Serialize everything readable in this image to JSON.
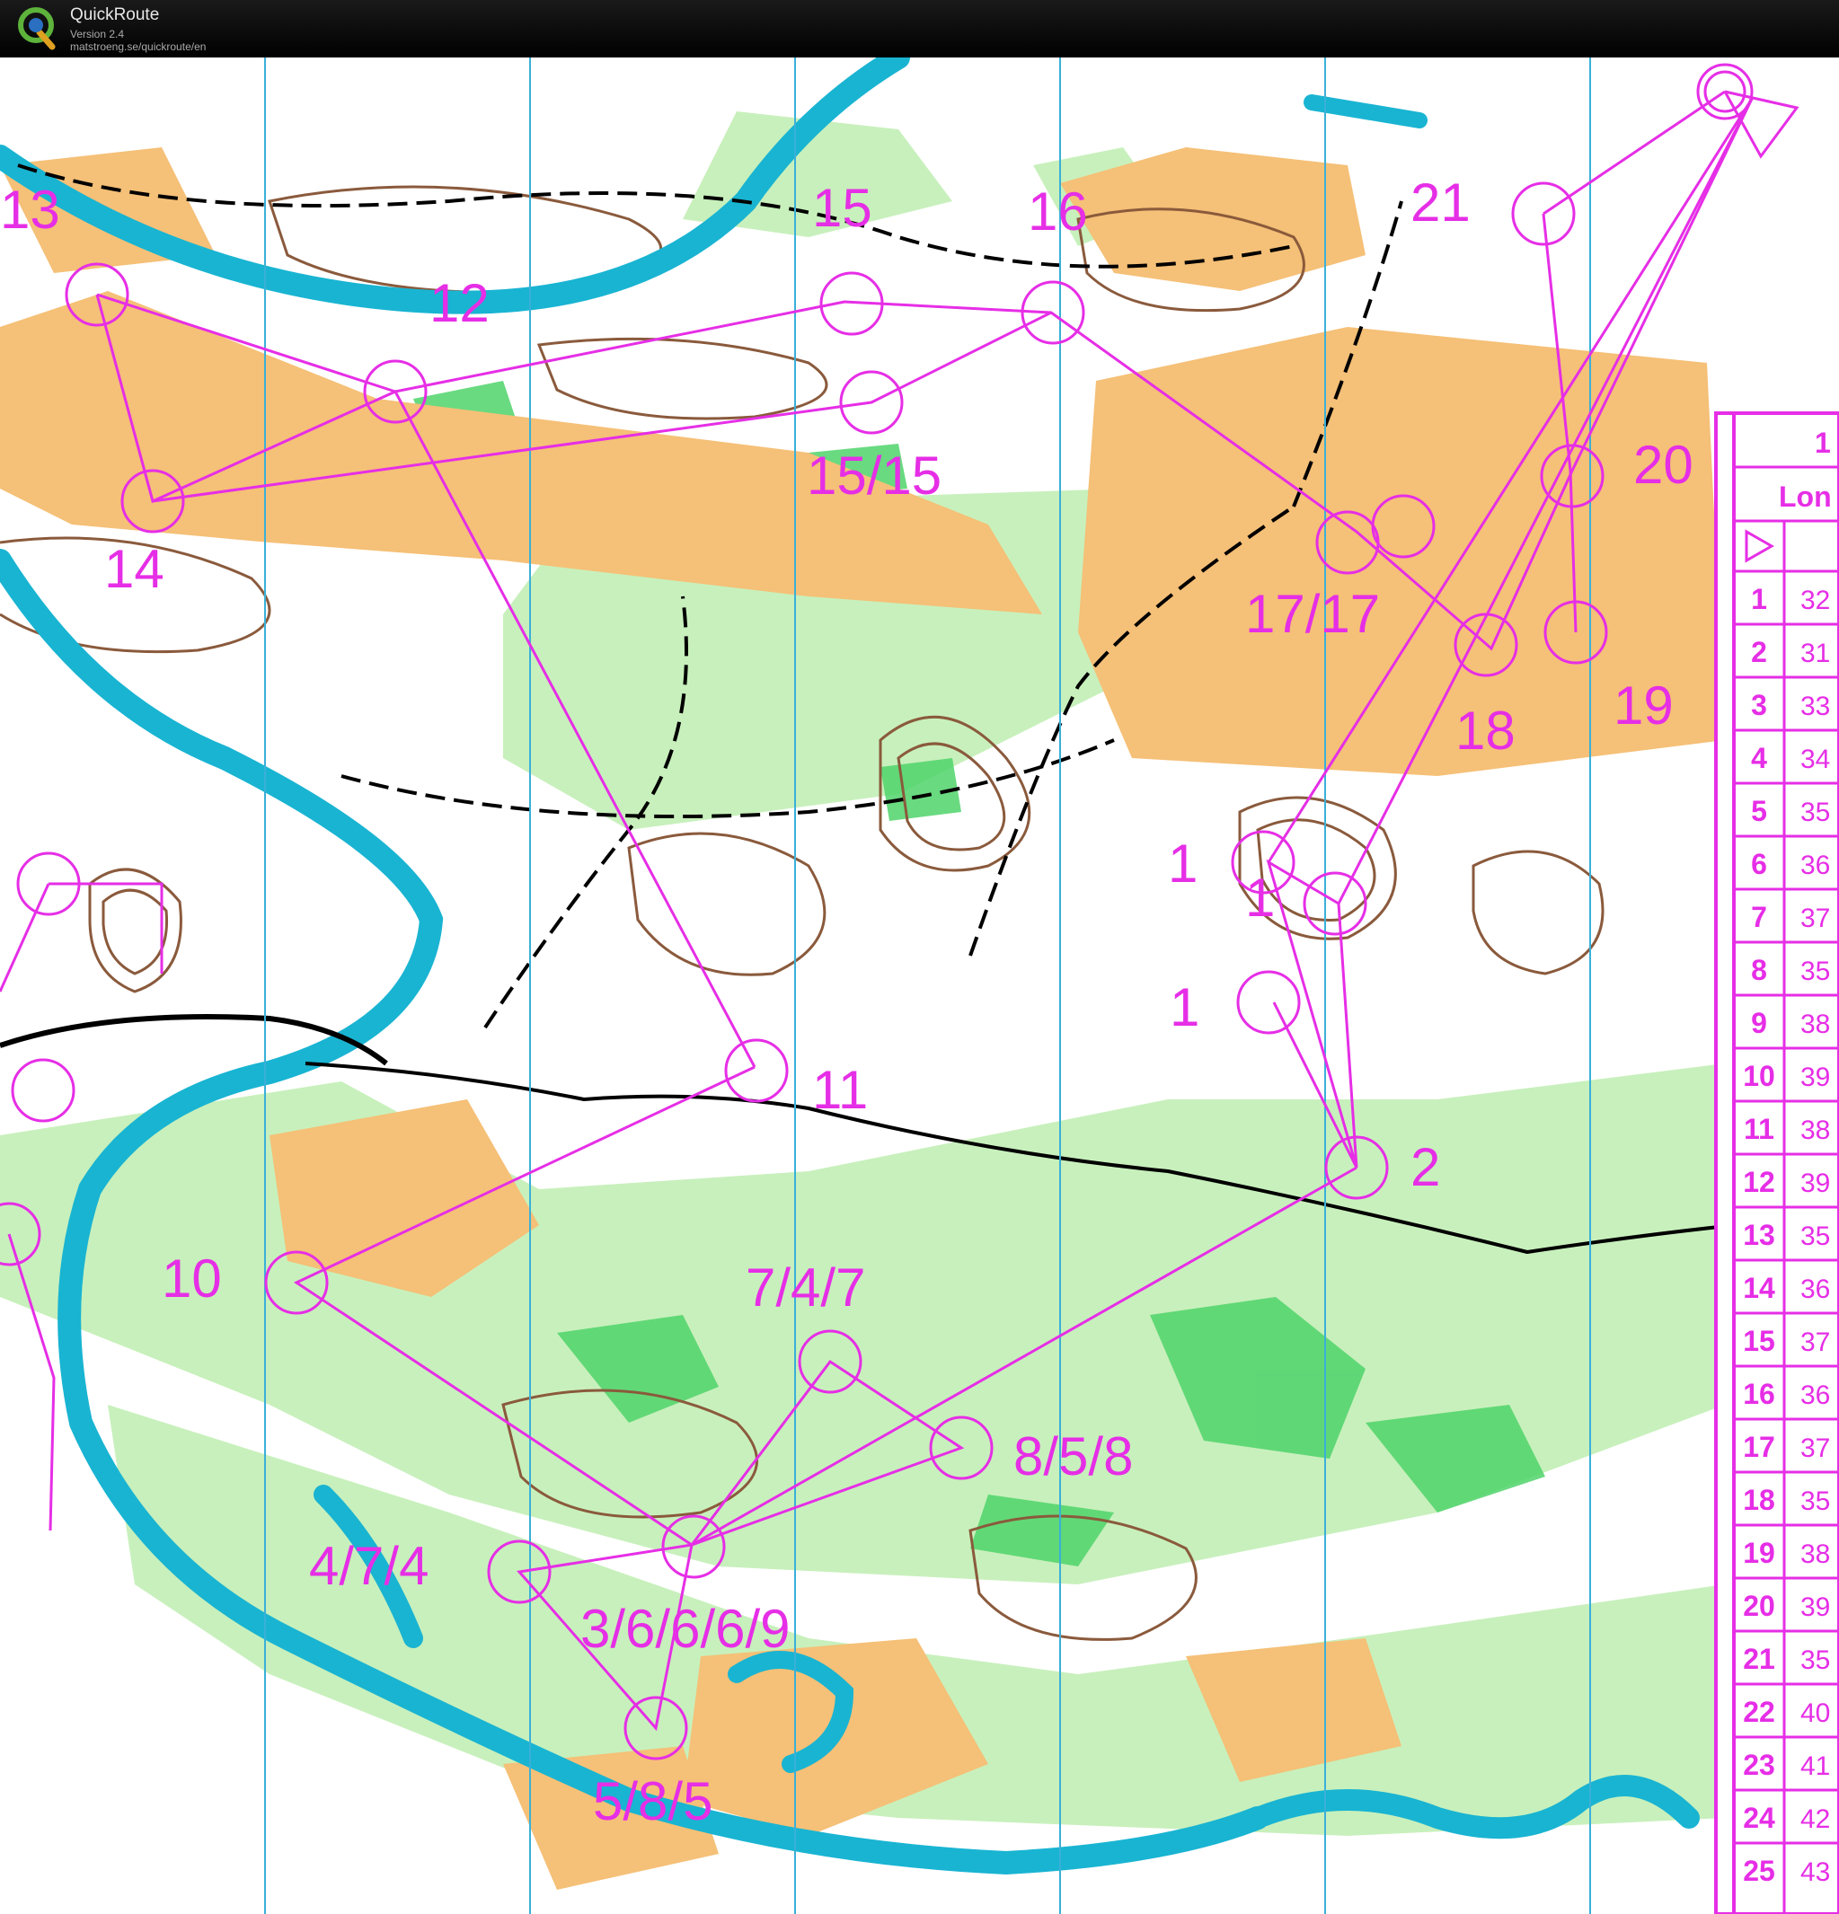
{
  "app": {
    "name": "QuickRoute",
    "version": "Version 2.4",
    "url": "matstroeng.se/quickroute/en",
    "logo_icon": "quickroute-logo-icon"
  },
  "map": {
    "type": "orienteering-map",
    "colors": {
      "open_land": "#f5c077",
      "forest": "#ffffff",
      "green": "#c8f0bc",
      "green_dark": "#4fd36a",
      "water": "#19b4d2",
      "contour": "#8a5a3c",
      "course": "#e62ee6",
      "meridian": "#3ab0d8"
    },
    "control_labels": [
      "13",
      "15",
      "16",
      "21",
      "12",
      "15/15",
      "20",
      "14",
      "17/17",
      "18",
      "19",
      "1",
      "1",
      "1",
      "11",
      "2",
      "10",
      "7/4/7",
      "8/5/8",
      "4/7/4",
      "3/6/6/6/9",
      "5/8/5"
    ]
  },
  "description_sheet": {
    "header_top": "1",
    "header_course": "Lon",
    "start_symbol": "start-triangle-icon",
    "rows": [
      {
        "n": "1",
        "code": "32"
      },
      {
        "n": "2",
        "code": "31"
      },
      {
        "n": "3",
        "code": "33"
      },
      {
        "n": "4",
        "code": "34"
      },
      {
        "n": "5",
        "code": "35"
      },
      {
        "n": "6",
        "code": "36"
      },
      {
        "n": "7",
        "code": "37"
      },
      {
        "n": "8",
        "code": "35"
      },
      {
        "n": "9",
        "code": "38"
      },
      {
        "n": "10",
        "code": "39"
      },
      {
        "n": "11",
        "code": "38"
      },
      {
        "n": "12",
        "code": "39"
      },
      {
        "n": "13",
        "code": "35"
      },
      {
        "n": "14",
        "code": "36"
      },
      {
        "n": "15",
        "code": "37"
      },
      {
        "n": "16",
        "code": "36"
      },
      {
        "n": "17",
        "code": "37"
      },
      {
        "n": "18",
        "code": "35"
      },
      {
        "n": "19",
        "code": "38"
      },
      {
        "n": "20",
        "code": "39"
      },
      {
        "n": "21",
        "code": "35"
      },
      {
        "n": "22",
        "code": "40"
      },
      {
        "n": "23",
        "code": "41"
      },
      {
        "n": "24",
        "code": "42"
      },
      {
        "n": "25",
        "code": "43"
      }
    ]
  }
}
